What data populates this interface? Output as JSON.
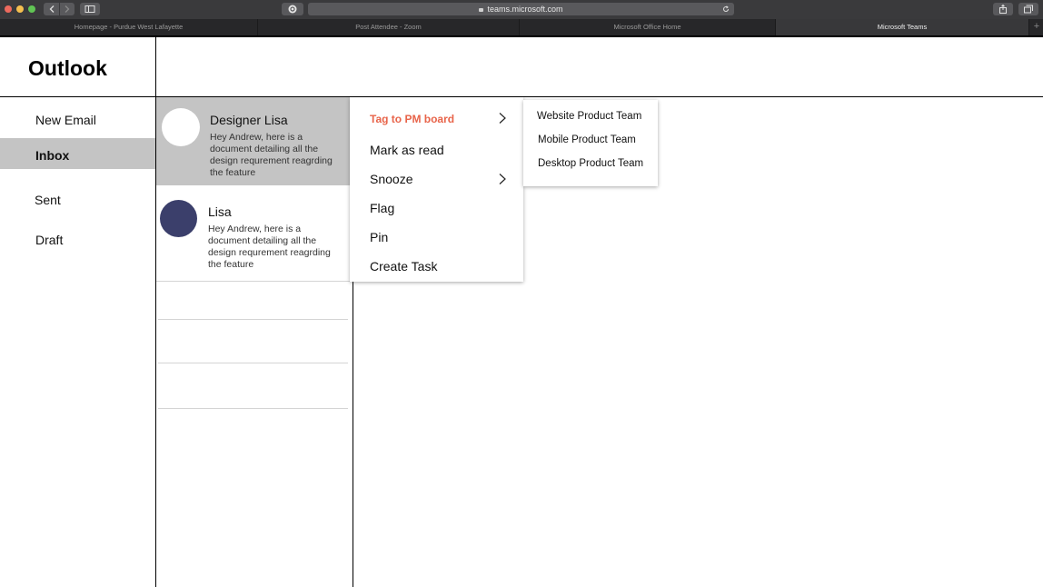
{
  "browser": {
    "url": "teams.microsoft.com",
    "tabs": [
      {
        "label": "Homepage - Purdue West Lafayette",
        "active": false
      },
      {
        "label": "Post Attendee - Zoom",
        "active": false
      },
      {
        "label": "Microsoft Office Home",
        "active": false
      },
      {
        "label": "Microsoft Teams",
        "active": true
      }
    ],
    "new_tab_label": "+"
  },
  "app": {
    "title": "Outlook"
  },
  "sidebar": {
    "items": [
      {
        "label": "New Email"
      },
      {
        "label": "Inbox",
        "selected": true
      },
      {
        "label": "Sent"
      },
      {
        "label": "Draft"
      }
    ]
  },
  "emails": [
    {
      "sender": "Designer Lisa",
      "preview": "Hey Andrew, here is a document detailing all the design requrement reagrding the feature",
      "selected": true,
      "avatar_color": "#ffffff"
    },
    {
      "sender": "Lisa",
      "preview": "Hey Andrew, here is a document detailing all the design requrement reagrding the feature",
      "selected": false,
      "avatar_color": "#3b3f6b"
    }
  ],
  "context_menu": {
    "items": [
      {
        "label": "Tag to PM board",
        "has_submenu": true,
        "highlighted": true
      },
      {
        "label": "Mark as read",
        "has_submenu": false
      },
      {
        "label": "Snooze",
        "has_submenu": true
      },
      {
        "label": "Flag",
        "has_submenu": false
      },
      {
        "label": "Pin",
        "has_submenu": false
      },
      {
        "label": "Create Task",
        "has_submenu": false
      }
    ]
  },
  "submenu": {
    "items": [
      {
        "label": "Website Product Team"
      },
      {
        "label": "Mobile Product Team"
      },
      {
        "label": "Desktop Product Team"
      }
    ]
  },
  "colors": {
    "accent": "#e8644a",
    "selection": "#c4c4c4",
    "avatar_dark": "#3b3f6b"
  }
}
